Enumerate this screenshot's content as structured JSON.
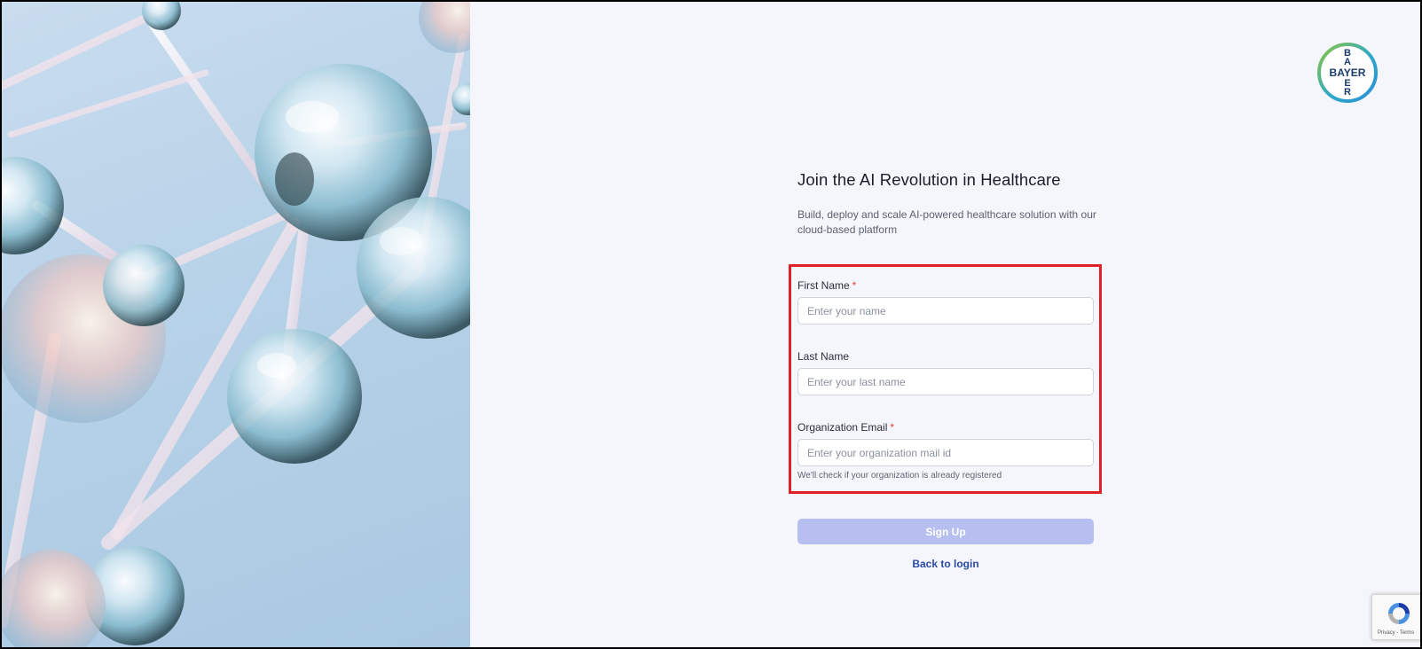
{
  "hero": {
    "alt": "molecular glass spheres illustration"
  },
  "brand": {
    "logo_text": "BAYER",
    "icon": "bayer-cross-logo"
  },
  "page": {
    "title": "Join the AI Revolution in Healthcare",
    "subtitle": "Build, deploy and scale AI-powered healthcare solution with our cloud-based platform"
  },
  "form": {
    "first_name": {
      "label": "First Name",
      "required_mark": "*",
      "placeholder": "Enter your name",
      "value": ""
    },
    "last_name": {
      "label": "Last Name",
      "placeholder": "Enter your last name",
      "value": ""
    },
    "org_email": {
      "label": "Organization Email",
      "required_mark": "*",
      "placeholder": "Enter your organization mail id",
      "value": "",
      "hint": "We'll check if your organization is already registered"
    },
    "highlight_color": "#e02027"
  },
  "actions": {
    "signup_label": "Sign Up",
    "back_label": "Back to login"
  },
  "recaptcha": {
    "text": "Privacy - Terms",
    "icon": "recaptcha-icon"
  },
  "colors": {
    "accent_button": "#b6bff0",
    "link": "#2a4aa6",
    "background": "#f5f6fb"
  }
}
